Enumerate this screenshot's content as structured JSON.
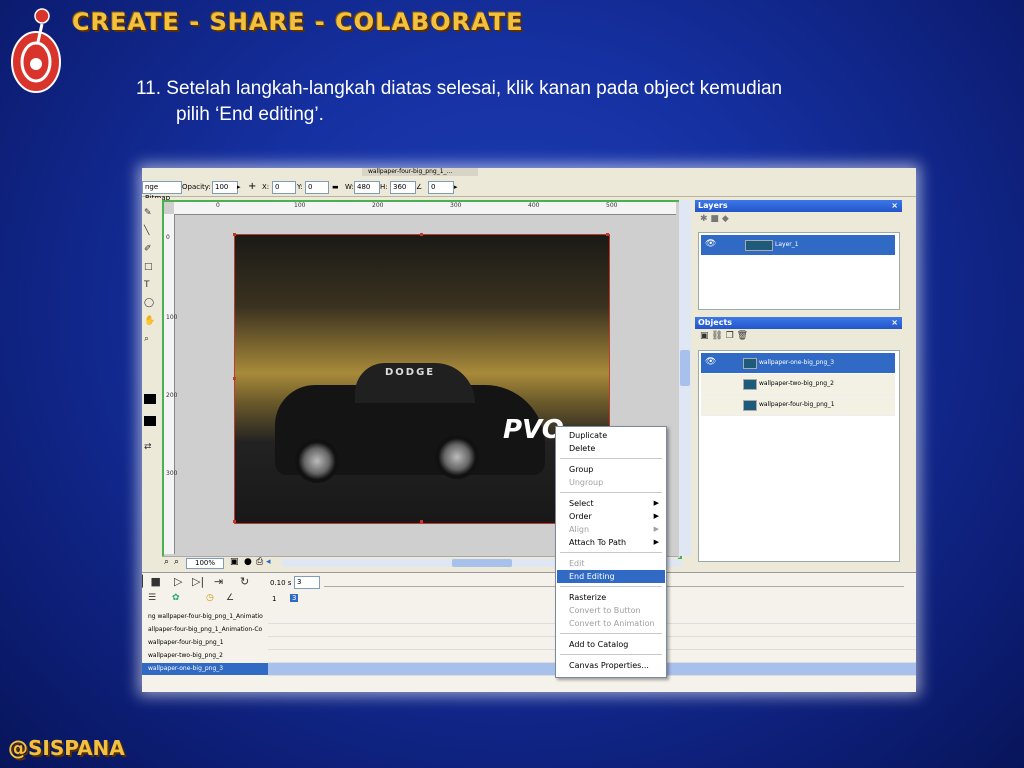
{
  "header": {
    "title": "CREATE - SHARE - COLABORATE"
  },
  "instruction": {
    "line1": "11. Setelah langkah-langkah diatas selesai, klik kanan pada object kemudian",
    "line2": "pilih ‘End editing’."
  },
  "footer": {
    "text": "@SISPANA"
  },
  "app": {
    "window_tab": "wallpaper-four-big_png_1_...",
    "properties": {
      "mode_label": "nge Bitmap",
      "opacity_label": "Opacity:",
      "opacity_value": "100",
      "x_label": "X:",
      "x_value": "0",
      "y_label": "Y:",
      "y_value": "0",
      "w_label": "W:",
      "w_value": "480",
      "h_label": "H:",
      "h_value": "360",
      "angle_value": "0"
    },
    "ruler_h": [
      "0",
      "100",
      "200",
      "300",
      "400",
      "500"
    ],
    "ruler_v": [
      "0",
      "100",
      "200",
      "300"
    ],
    "car_brand": "DODGE",
    "car_decal": "PVO",
    "zoom": "100%",
    "layers_panel": {
      "title": "Layers",
      "close": "×",
      "items": [
        {
          "name": "Layer_1"
        }
      ]
    },
    "objects_panel": {
      "title": "Objects",
      "close": "×",
      "items": [
        {
          "name": "wallpaper-one-big_png_3"
        },
        {
          "name": "wallpaper-two-big_png_2"
        },
        {
          "name": "wallpaper-four-big_png_1"
        }
      ]
    },
    "timeline": {
      "frame_time": "0.10 s",
      "frame_value": "3",
      "frame_numbers": [
        "1",
        "3"
      ],
      "rows": [
        "ng wallpaper-four-big_png_1_Animatio",
        "allpaper-four-big_png_1_Animation-Co",
        "wallpaper-four-big_png_1",
        "wallpaper-two-big_png_2",
        "wallpaper-one-big_png_3"
      ]
    },
    "context_menu": {
      "items": [
        {
          "label": "Duplicate"
        },
        {
          "label": "Delete"
        },
        {
          "label": "Group"
        },
        {
          "label": "Ungroup"
        },
        {
          "label": "Select"
        },
        {
          "label": "Order"
        },
        {
          "label": "Align"
        },
        {
          "label": "Attach To Path"
        },
        {
          "label": "Edit"
        },
        {
          "label": "End Editing"
        },
        {
          "label": "Rasterize"
        },
        {
          "label": "Convert to Button"
        },
        {
          "label": "Convert to Animation"
        },
        {
          "label": "Add to Catalog"
        },
        {
          "label": "Canvas Properties..."
        }
      ]
    }
  },
  "colors": {
    "background": "#1530a0",
    "header_gold": "#f2c140",
    "selection_blue": "#316ac5",
    "panel_title": "#2255c9"
  },
  "icons": [
    "logo-icon",
    "eye-icon",
    "image-thumb-icon",
    "submenu-arrow-icon"
  ]
}
